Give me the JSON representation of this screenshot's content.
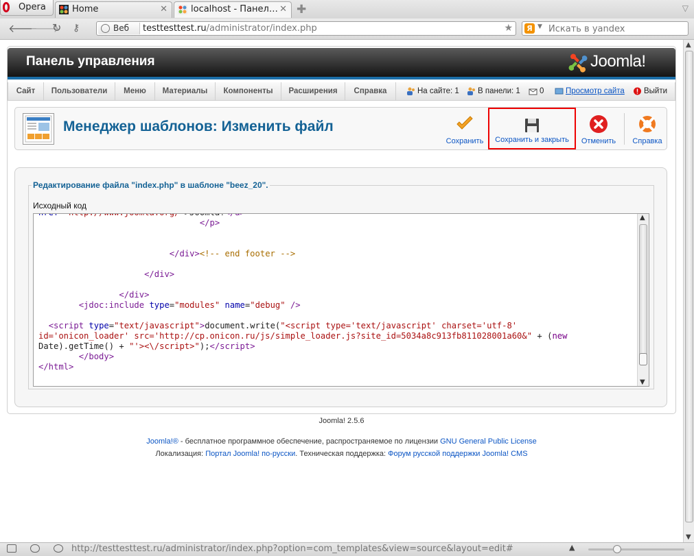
{
  "browser": {
    "menu_label": "Opera",
    "tabs": [
      {
        "label": "Home",
        "favicon": "joomla-favicon"
      },
      {
        "label": "localhost - Панел…",
        "favicon": "joomla-favicon"
      }
    ],
    "address": {
      "badge": "Веб",
      "host": "testtesttest.ru",
      "path": "/administrator/index.php"
    },
    "search_placeholder": "Искать в yandex",
    "status_url": "http://testtesttest.ru/administrator/index.php?option=com_templates&view=source&layout=edit#"
  },
  "header": {
    "title": "Панель управления",
    "logo_text": "Joomla!",
    "logo_mark": "®"
  },
  "menu": {
    "items": [
      "Сайт",
      "Пользователи",
      "Меню",
      "Материалы",
      "Компоненты",
      "Расширения",
      "Справка"
    ],
    "status": {
      "on_site": "На сайте: 1",
      "in_admin": "В панели: 1",
      "messages": "0",
      "view_site": "Просмотр сайта",
      "logout": "Выйти"
    }
  },
  "toolbar": {
    "page_title": "Менеджер шаблонов: Изменить файл",
    "save": "Сохранить",
    "save_close": "Сохранить и закрыть",
    "cancel": "Отменить",
    "help": "Справка"
  },
  "form": {
    "legend": "Редактирование файла \"index.php\" в шаблоне \"beez_20\".",
    "source_label": "Исходный код"
  },
  "footer": {
    "version": "Joomla! 2.5.6",
    "license_link": "Joomla!®",
    "license_text": " - бесплатное программное обеспечение, распространяемое по лицензии ",
    "gpl_link": "GNU General Public License",
    "loc_prefix": "Локализация: ",
    "loc_link": "Портал Joomla! по-русски",
    "support_text": ". Техническая поддержка: ",
    "support_link": "Форум русской поддержки Joomla! CMS"
  },
  "colors": {
    "header_gradient_top": "#5a5a5a",
    "header_gradient_bottom": "#141414",
    "accent_blue": "#146295",
    "link_blue": "#0b55c4",
    "highlight_red": "#ee0000"
  }
}
